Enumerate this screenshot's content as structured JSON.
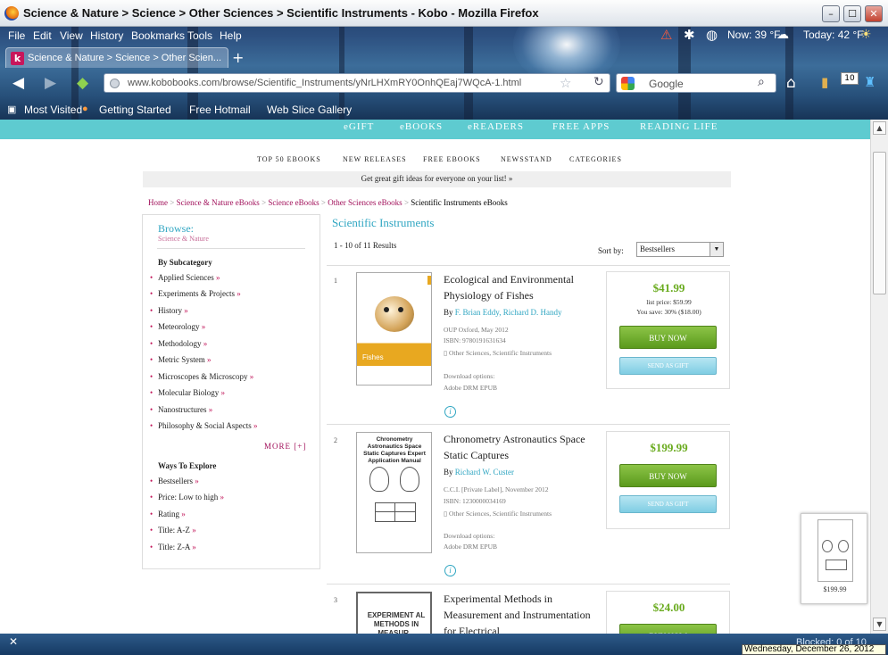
{
  "window": {
    "title": "Science & Nature > Science > Other Sciences > Scientific Instruments - Kobo - Mozilla Firefox",
    "controls": {
      "minimize": "–",
      "maximize": "☐",
      "close": "✕"
    }
  },
  "menu": [
    "File",
    "Edit",
    "View",
    "History",
    "Bookmarks",
    "Tools",
    "Help"
  ],
  "weather": {
    "now": "Now: 39 °F",
    "today": "Today: 42 °F"
  },
  "tab": {
    "icon": "k",
    "label": "Science & Nature > Science > Other Scien...",
    "new_tab": "+"
  },
  "address": {
    "url": "www.kobobooks.com/browse/Scientific_Instruments/yNrLHXmRY0OnhQEaj7WQcA-1.html",
    "search_engine": "Google"
  },
  "toolbar_badge": "10",
  "bookmarks": [
    "Most Visited",
    "Getting Started",
    "Free Hotmail",
    "Web Slice Gallery"
  ],
  "site_nav": [
    "eGIFT",
    "eBOOKS",
    "eREADERS",
    "FREE APPS",
    "READING LIFE"
  ],
  "sub_nav": [
    "TOP 50 EBOOKS",
    "NEW RELEASES",
    "FREE EBOOKS",
    "NEWSSTAND",
    "CATEGORIES"
  ],
  "gift_banner": "Get great gift ideas for everyone on your list! »",
  "breadcrumb": {
    "links": [
      "Home",
      "Science & Nature eBooks",
      "Science eBooks",
      "Other Sciences eBooks"
    ],
    "current": "Scientific Instruments eBooks",
    "sep": ">"
  },
  "sidebar": {
    "heading": "Browse:",
    "sub": "Science & Nature",
    "subcat_heading": "By Subcategory",
    "subcategories": [
      "Applied Sciences",
      "Experiments & Projects",
      "History",
      "Meteorology",
      "Methodology",
      "Metric System",
      "Microscopes & Microscopy",
      "Molecular Biology",
      "Nanostructures",
      "Philosophy & Social Aspects"
    ],
    "more": "MORE [+]",
    "ways_heading": "Ways To Explore",
    "ways": [
      "Bestsellers",
      "Price: Low to high",
      "Rating",
      "Title: A-Z",
      "Title: Z-A"
    ]
  },
  "main": {
    "heading": "Scientific Instruments",
    "results": "1 - 10 of 11 Results",
    "sort_label": "Sort by:",
    "sort_value": "Bestsellers"
  },
  "books": [
    {
      "num": "1",
      "title": "Ecological and Environmental Physiology of Fishes",
      "by": "By",
      "authors": "F. Brian Eddy, Richard D. Handy",
      "publisher": "OUP Oxford, May 2012",
      "isbn": "ISBN: 9780191631634",
      "categories": "Other Sciences, Scientific Instruments",
      "download_label": "Download options:",
      "download_formats": "Adobe DRM EPUB",
      "price": "$41.99",
      "list_price": "list price: $59.99",
      "you_save": "You save: 30% ($18.00)",
      "buy": "BUY NOW",
      "gift": "SEND AS GIFT",
      "cover_title": "Fishes"
    },
    {
      "num": "2",
      "title": "Chronometry Astronautics Space Static Captures",
      "by": "By",
      "authors": "Richard W. Custer",
      "publisher": "C.C.I. [Private Label], November 2012",
      "isbn": "ISBN: 1230000034169",
      "categories": "Other Sciences, Scientific Instruments",
      "download_label": "Download options:",
      "download_formats": "Adobe DRM EPUB",
      "price": "$199.99",
      "buy": "BUY NOW",
      "gift": "SEND AS GIFT",
      "cover_title": "Chronometry Astronautics Space Static Captures Expert Application Manual"
    },
    {
      "num": "3",
      "title": "Experimental Methods in Measurement and Instrumentation for Electrical",
      "price": "$24.00",
      "buy": "BUY NOW",
      "cover_title": "EXPERIMENT AL METHODS IN MEASUR..."
    }
  ],
  "float_thumb_price": "$199.99",
  "status": {
    "blocked": "Blocked: 0 of 10",
    "date": "Wednesday, December 26, 2012"
  },
  "colors": {
    "kobo_teal": "#5ecbd0",
    "link_magenta": "#a1105a",
    "heading_blue": "#30a6c2",
    "price_green": "#6aab1f"
  }
}
